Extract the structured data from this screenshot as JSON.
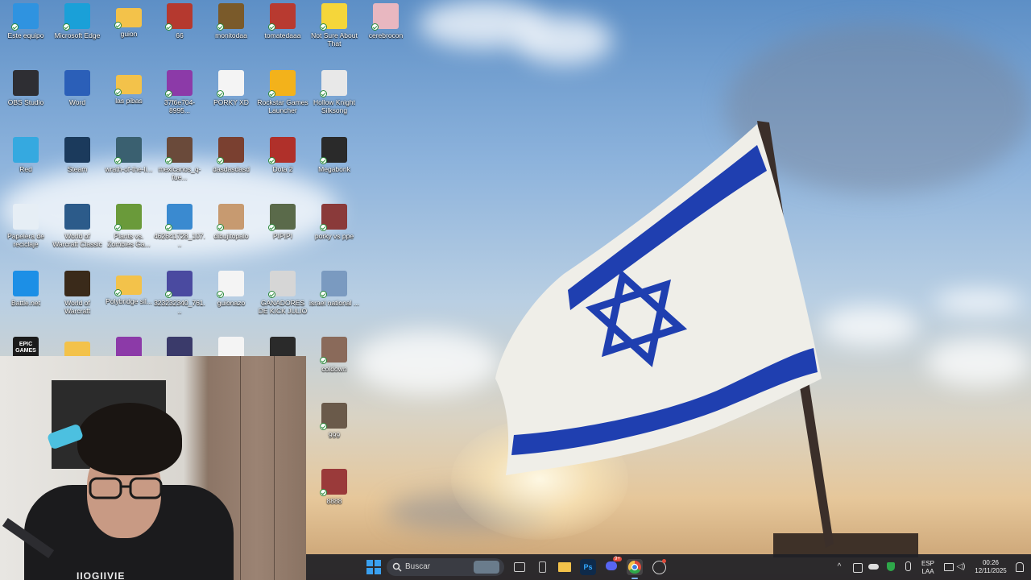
{
  "desktop": {
    "icons": [
      {
        "label": "Este equipo",
        "icon": "monitor-icon",
        "color": "#2f93e0",
        "col": 0,
        "row": 0
      },
      {
        "label": "Microsoft Edge",
        "icon": "edge-icon",
        "color": "#1aa0d8",
        "col": 1,
        "row": 0
      },
      {
        "label": "guion",
        "icon": "folder-icon",
        "color": "#f3c24a",
        "col": 2,
        "row": 0
      },
      {
        "label": "66",
        "icon": "image-file-icon",
        "color": "#b5392f",
        "col": 3,
        "row": 0
      },
      {
        "label": "monitodaa",
        "icon": "image-file-icon",
        "color": "#7a5a2a",
        "col": 4,
        "row": 0
      },
      {
        "label": "tomatedaaa",
        "icon": "image-file-icon",
        "color": "#b83a30",
        "col": 5,
        "row": 0
      },
      {
        "label": "Not Sure About That",
        "icon": "image-file-icon",
        "color": "#f5d63a",
        "col": 6,
        "row": 0
      },
      {
        "label": "cerebrocon",
        "icon": "image-file-icon",
        "color": "#e8b7c0",
        "col": 7,
        "row": 0
      },
      {
        "label": "OBS Studio",
        "icon": "obs-icon",
        "color": "#2e2e33",
        "col": 0,
        "row": 1
      },
      {
        "label": "Word",
        "icon": "word-icon",
        "color": "#2b5fb8",
        "col": 1,
        "row": 1
      },
      {
        "label": "las pibas",
        "icon": "folder-icon",
        "color": "#f3c24a",
        "col": 2,
        "row": 1
      },
      {
        "label": "37f6e704-8995...",
        "icon": "file-icon",
        "color": "#8c3aa8",
        "col": 3,
        "row": 1
      },
      {
        "label": "PORKY XD",
        "icon": "video-file-icon",
        "color": "#f4f4f4",
        "col": 4,
        "row": 1
      },
      {
        "label": "Rockstar Games Launcher",
        "icon": "rockstar-icon",
        "color": "#f3b21b",
        "col": 5,
        "row": 1
      },
      {
        "label": "Hollow Knight Silksong",
        "icon": "hollow-knight-icon",
        "color": "#e8e8e8",
        "col": 6,
        "row": 1
      },
      {
        "label": "Red",
        "icon": "network-icon",
        "color": "#35a9e0",
        "col": 0,
        "row": 2
      },
      {
        "label": "Steam",
        "icon": "steam-icon",
        "color": "#1b3a5c",
        "col": 1,
        "row": 2
      },
      {
        "label": "wrath-of-the-li...",
        "icon": "image-file-icon",
        "color": "#3a6070",
        "col": 2,
        "row": 2
      },
      {
        "label": "mexicanos_q-fue...",
        "icon": "image-file-icon",
        "color": "#6a4a3a",
        "col": 3,
        "row": 2
      },
      {
        "label": "dasdasdasd",
        "icon": "image-file-icon",
        "color": "#7a4030",
        "col": 4,
        "row": 2
      },
      {
        "label": "Dota 2",
        "icon": "dota-icon",
        "color": "#b0302a",
        "col": 5,
        "row": 2
      },
      {
        "label": "Megabonk",
        "icon": "megabonk-icon",
        "color": "#2a2a2a",
        "col": 6,
        "row": 2
      },
      {
        "label": "Papelera de reciclaje",
        "icon": "recycle-bin-icon",
        "color": "#e6eef5",
        "col": 0,
        "row": 3
      },
      {
        "label": "World of Warcraft Classic",
        "icon": "wow-icon",
        "color": "#2c5b8a",
        "col": 1,
        "row": 3
      },
      {
        "label": "Plants vs. Zombies Ga...",
        "icon": "pvz-icon",
        "color": "#6a9a3a",
        "col": 2,
        "row": 3
      },
      {
        "label": "462641728_107...",
        "icon": "image-file-icon",
        "color": "#3a8ad0",
        "col": 3,
        "row": 3
      },
      {
        "label": "dibujitopalo",
        "icon": "image-file-icon",
        "color": "#c79a70",
        "col": 4,
        "row": 3
      },
      {
        "label": "PIPIPI",
        "icon": "image-file-icon",
        "color": "#5a6a4a",
        "col": 5,
        "row": 3
      },
      {
        "label": "porky vs ppe",
        "icon": "image-file-icon",
        "color": "#8a3a3a",
        "col": 6,
        "row": 3
      },
      {
        "label": "Battle.net",
        "icon": "battlenet-icon",
        "color": "#1c8fe6",
        "col": 0,
        "row": 4
      },
      {
        "label": "World of Warcraft",
        "icon": "wow-icon",
        "color": "#3a2a1a",
        "col": 1,
        "row": 4
      },
      {
        "label": "Polybridge sil...",
        "icon": "folder-icon",
        "color": "#f3c24a",
        "col": 2,
        "row": 4
      },
      {
        "label": "323232340_761...",
        "icon": "image-file-icon",
        "color": "#4a4aa0",
        "col": 3,
        "row": 4
      },
      {
        "label": "guionazo",
        "icon": "text-file-icon",
        "color": "#f4f4f4",
        "col": 4,
        "row": 4
      },
      {
        "label": "GANADORES DE KICK JULIO",
        "icon": "image-file-icon",
        "color": "#d6d6d6",
        "col": 5,
        "row": 4
      },
      {
        "label": "israel national ...",
        "icon": "image-file-icon",
        "color": "#7a9ac0",
        "col": 6,
        "row": 4
      },
      {
        "label": "",
        "icon": "epic-games-icon",
        "color": "#1b1b1b",
        "col": 0,
        "row": 5
      },
      {
        "label": "",
        "icon": "folder-icon",
        "color": "#f3c24a",
        "col": 1,
        "row": 5
      },
      {
        "label": "",
        "icon": "image-file-icon",
        "color": "#8c3aa8",
        "col": 2,
        "row": 5
      },
      {
        "label": "",
        "icon": "image-file-icon",
        "color": "#3a3a6a",
        "col": 3,
        "row": 5
      },
      {
        "label": "",
        "icon": "video-file-icon",
        "color": "#f4f4f4",
        "col": 4,
        "row": 5
      },
      {
        "label": "",
        "icon": "image-file-icon",
        "color": "#2a2a2a",
        "col": 5,
        "row": 5
      },
      {
        "label": "coldown",
        "icon": "image-file-icon",
        "color": "#8a6a5a",
        "col": 6,
        "row": 5
      },
      {
        "label": "999",
        "icon": "image-file-icon",
        "color": "#6a5a4a",
        "col": 6,
        "row": 6
      },
      {
        "label": "8888",
        "icon": "image-file-icon",
        "color": "#9a3a3a",
        "col": 6,
        "row": 7
      }
    ],
    "epic_label": "EPIC GAMES"
  },
  "webcam": {
    "hoodie_text": "IIOGIIVIE"
  },
  "taskbar": {
    "search_placeholder": "Buscar",
    "apps": [
      {
        "name": "start-button",
        "icon": "windows-icon",
        "color": "#3aa0f0"
      },
      {
        "name": "task-view-button",
        "icon": "task-view-icon",
        "color": "#d0d0d0"
      },
      {
        "name": "phone-link-button",
        "icon": "phone-icon",
        "color": "#c0c0c0"
      },
      {
        "name": "file-explorer-button",
        "icon": "folder-icon",
        "color": "#f3c24a"
      },
      {
        "name": "photoshop-button",
        "icon": "photoshop-icon",
        "color": "#0e2a4a"
      },
      {
        "name": "discord-button",
        "icon": "discord-icon",
        "color": "#5865f2"
      },
      {
        "name": "chrome-button",
        "icon": "chrome-icon",
        "color": "#e04a3a"
      },
      {
        "name": "obs-button",
        "icon": "obs-icon",
        "color": "#2e2e33"
      }
    ],
    "discord_badge": "9+",
    "tray": {
      "language_line1": "ESP",
      "language_line2": "LAA",
      "time": "00:26",
      "date": "12/11/2025"
    }
  },
  "colors": {
    "flag_blue": "#1f3fb0",
    "flag_white": "#efeee8",
    "taskbar_bg": "#1e2026"
  }
}
